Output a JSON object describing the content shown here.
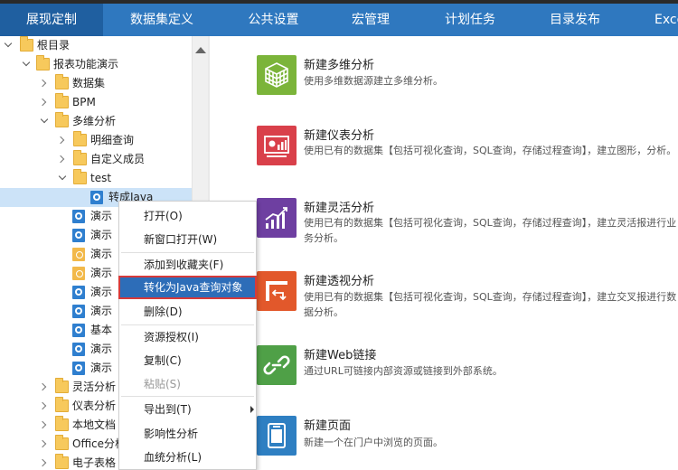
{
  "nav": {
    "tabs": [
      {
        "label": "展现定制"
      },
      {
        "label": "数据集定义"
      },
      {
        "label": "公共设置"
      },
      {
        "label": "宏管理"
      },
      {
        "label": "计划任务"
      },
      {
        "label": "目录发布"
      },
      {
        "label": "Exce"
      }
    ],
    "active_index": 0
  },
  "tree": {
    "items": [
      {
        "label": "根目录",
        "type": "folder",
        "expanded": true
      },
      {
        "label": "报表功能演示",
        "type": "folder",
        "expanded": true
      },
      {
        "label": "数据集",
        "type": "folder",
        "expanded": false
      },
      {
        "label": "BPM",
        "type": "folder",
        "expanded": false
      },
      {
        "label": "多维分析",
        "type": "folder",
        "expanded": true
      },
      {
        "label": "明细查询",
        "type": "folder",
        "expanded": false
      },
      {
        "label": "自定义成员",
        "type": "folder",
        "expanded": false
      },
      {
        "label": "test",
        "type": "folder",
        "expanded": true
      },
      {
        "label": "转成Java",
        "type": "report",
        "selected": true
      },
      {
        "label": "演示",
        "type": "report"
      },
      {
        "label": "演示",
        "type": "report"
      },
      {
        "label": "演示",
        "type": "lock"
      },
      {
        "label": "演示",
        "type": "lock"
      },
      {
        "label": "演示",
        "type": "report"
      },
      {
        "label": "演示",
        "type": "report"
      },
      {
        "label": "基本",
        "type": "report"
      },
      {
        "label": "演示",
        "type": "report"
      },
      {
        "label": "演示",
        "type": "report"
      },
      {
        "label": "灵活分析",
        "type": "folder",
        "expanded": false
      },
      {
        "label": "仪表分析",
        "type": "folder",
        "expanded": false
      },
      {
        "label": "本地文档",
        "type": "folder",
        "expanded": false
      },
      {
        "label": "Office分析",
        "type": "folder",
        "expanded": false
      },
      {
        "label": "电子表格",
        "type": "folder",
        "expanded": false
      }
    ]
  },
  "context_menu": {
    "items": [
      {
        "label": "打开(O)"
      },
      {
        "label": "新窗口打开(W)"
      },
      {
        "label": "添加到收藏夹(F)"
      },
      {
        "label": "转化为Java查询对象",
        "highlighted": true
      },
      {
        "label": "删除(D)"
      },
      {
        "label": "资源授权(I)"
      },
      {
        "label": "复制(C)"
      },
      {
        "label": "粘贴(S)",
        "disabled": true
      },
      {
        "label": "导出到(T)",
        "submenu": true
      },
      {
        "label": "影响性分析"
      },
      {
        "label": "血统分析(L)"
      }
    ]
  },
  "cards": [
    {
      "title": "新建多维分析",
      "desc": "使用多维数据源建立多维分析。",
      "icon": "cube-icon",
      "color": "#7bb43a"
    },
    {
      "title": "新建仪表分析",
      "desc": "使用已有的数据集【包括可视化查询，SQL查询，存储过程查询】，建立图形，分析。",
      "icon": "dashboard-icon",
      "color": "#d9404a"
    },
    {
      "title": "新建灵活分析",
      "desc": "使用已有的数据集【包括可视化查询，SQL查询，存储过程查询】，建立灵活报进行业务分析。",
      "icon": "trend-chart-icon",
      "color": "#6e3fa1"
    },
    {
      "title": "新建透视分析",
      "desc": "使用已有的数据集【包括可视化查询，SQL查询，存储过程查询】，建立交叉报进行数据分析。",
      "icon": "pivot-icon",
      "color": "#e2582b"
    },
    {
      "title": "新建Web链接",
      "desc": "通过URL可链接内部资源或链接到外部系统。",
      "icon": "link-icon",
      "color": "#4fa047"
    },
    {
      "title": "新建页面",
      "desc": "新建一个在门户中浏览的页面。",
      "icon": "page-icon",
      "color": "#2e7fc2"
    }
  ]
}
